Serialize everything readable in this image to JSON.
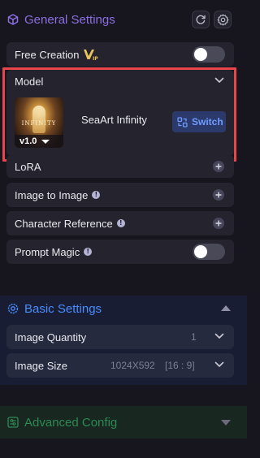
{
  "general": {
    "title": "General Settings",
    "free_creation_label": "Free Creation",
    "model_label": "Model",
    "model_name": "SeaArt Infinity",
    "model_version": "v1.0",
    "thumbnail_text": "INFINITY",
    "switch_label": "Switch",
    "lora_label": "LoRA",
    "image_to_image_label": "Image to Image",
    "character_reference_label": "Character Reference",
    "prompt_magic_label": "Prompt Magic",
    "free_creation_on": false,
    "prompt_magic_on": false
  },
  "basic": {
    "title": "Basic Settings",
    "image_quantity_label": "Image Quantity",
    "image_quantity_value": "1",
    "image_size_label": "Image Size",
    "image_size_value": "1024X592",
    "image_size_ratio": "[16 : 9]"
  },
  "advanced": {
    "title": "Advanced Config"
  },
  "icons": {
    "general": "cube-icon",
    "refresh": "refresh-icon",
    "settings": "gear-icon",
    "vip": "vip-badge-icon",
    "switch": "swap-icon",
    "basic": "settings-circle-icon",
    "advanced": "sliders-icon"
  },
  "colors": {
    "general_accent": "#8b6fe0",
    "basic_accent": "#4b8cff",
    "advanced_accent": "#2e8a55",
    "highlight_frame": "#e9464b",
    "vip_gold": "#e8c25a"
  }
}
